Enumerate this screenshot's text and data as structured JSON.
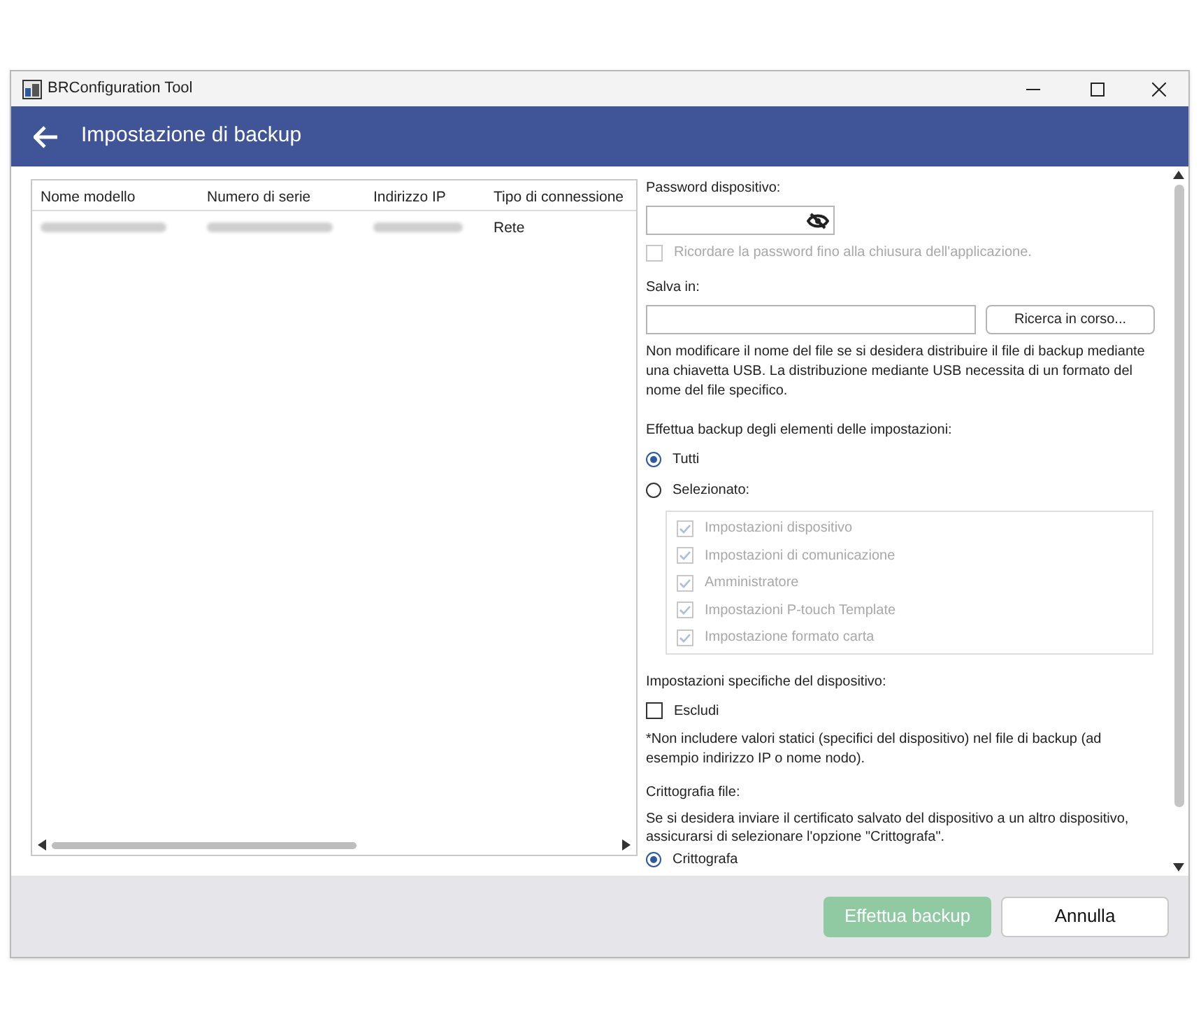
{
  "window": {
    "title": "BRConfiguration Tool"
  },
  "header": {
    "title": "Impostazione di backup"
  },
  "table": {
    "columns": [
      "Nome modello",
      "Numero di serie",
      "Indirizzo IP",
      "Tipo di connessione"
    ],
    "rows": [
      {
        "cells": [
          {
            "kind": "blurred"
          },
          {
            "kind": "blurred"
          },
          {
            "kind": "blurred"
          },
          {
            "kind": "text",
            "text": "Rete"
          }
        ]
      }
    ]
  },
  "form": {
    "password_label": "Password dispositivo:",
    "remember": {
      "label": "Ricordare la password fino alla chiusura dell'applicazione.",
      "checked": false,
      "disabled": true
    },
    "save_label": "Salva in:",
    "browse_button": "Ricerca in corso...",
    "save_note": "Non modificare il nome del file se si desidera distribuire il file di backup mediante una chiavetta USB. La distribuzione mediante USB necessita di un formato del nome del file specifico.",
    "backup_label": "Effettua backup degli elementi delle impostazioni:",
    "backup_options": [
      {
        "label": "Tutti",
        "selected": true
      },
      {
        "label": "Selezionato:",
        "selected": false
      }
    ],
    "items": [
      {
        "label": "Impostazioni dispositivo",
        "checked": true,
        "disabled": true
      },
      {
        "label": "Impostazioni di comunicazione",
        "checked": true,
        "disabled": true
      },
      {
        "label": "Amministratore",
        "checked": true,
        "disabled": true
      },
      {
        "label": "Impostazioni P-touch Template",
        "checked": true,
        "disabled": true
      },
      {
        "label": "Impostazione formato carta",
        "checked": true,
        "disabled": true
      }
    ],
    "specific_label": "Impostazioni specifiche del dispositivo:",
    "exclude": {
      "label": "Escludi",
      "checked": false
    },
    "exclude_note": "*Non includere valori statici (specifici del dispositivo) nel file di backup (ad esempio indirizzo IP o nome nodo).",
    "encryption_label": "Crittografia file:",
    "encryption_note": "Se si desidera inviare il certificato salvato del dispositivo a un altro dispositivo, assicurarsi di selezionare l'opzione \"Crittografa\".",
    "encryption_options": [
      {
        "label": "Crittografa",
        "selected": true
      }
    ]
  },
  "footer": {
    "primary": {
      "label": "Effettua backup",
      "disabled": true
    },
    "cancel": "Annulla"
  }
}
